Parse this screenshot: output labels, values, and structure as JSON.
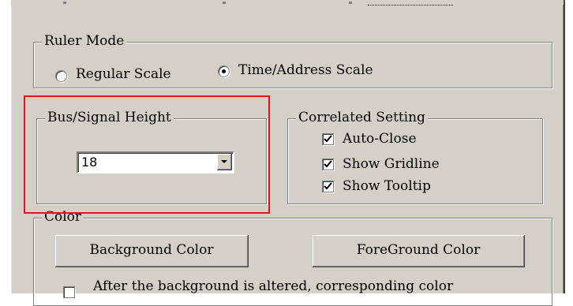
{
  "ruler_mode": {
    "title": "Ruler Mode",
    "options": [
      {
        "label": "Regular Scale",
        "selected": false
      },
      {
        "label": "Time/Address Scale",
        "selected": true
      }
    ]
  },
  "bus_signal_height": {
    "title": "Bus/Signal Height",
    "value": "18"
  },
  "correlated_setting": {
    "title": "Correlated Setting",
    "items": [
      {
        "label": "Auto-Close",
        "checked": true
      },
      {
        "label": "Show Gridline",
        "checked": true
      },
      {
        "label": "Show Tooltip",
        "checked": true
      }
    ]
  },
  "color": {
    "title": "Color",
    "background_button": "Background Color",
    "foreground_button": "ForeGround Color",
    "after_change_checkbox": {
      "label": "After the background is altered, corresponding color",
      "checked": false
    }
  },
  "colors": {
    "face": "#d4d0c8",
    "highlight_border": "#e8101a"
  }
}
